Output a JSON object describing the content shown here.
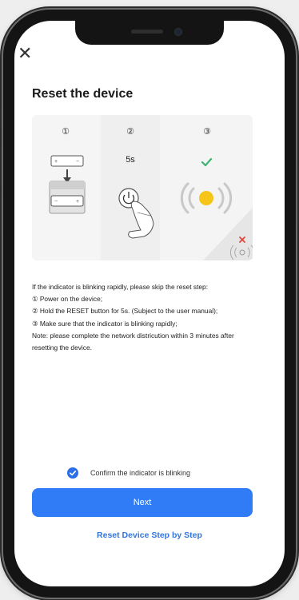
{
  "screen": {
    "close_icon": "close-icon",
    "title": "Reset the device"
  },
  "illustration": {
    "steps": [
      {
        "number": "①",
        "icon": "device-insert-icon"
      },
      {
        "number": "②",
        "hold_time": "5s",
        "icon": "power-button-press-icon"
      },
      {
        "number": "③",
        "icon": "indicator-blinking-icon"
      }
    ],
    "colors": {
      "check": "#3cb371",
      "indicator": "#f5c518",
      "error": "#e0453a"
    }
  },
  "instructions": [
    "If the indicator is blinking rapidly, please skip the reset step:",
    "① Power on the device;",
    "② Hold the RESET button for 5s. (Subject to the user manual);",
    "③ Make sure that the indicator is blinking rapidly;",
    "Note: please complete the network districution within 3 minutes after resetting the device."
  ],
  "confirm": {
    "label": "Confirm the indicator is blinking",
    "checked": true
  },
  "actions": {
    "next_label": "Next",
    "step_link_label": "Reset Device Step by Step"
  },
  "colors": {
    "accent": "#2f7cf6",
    "link": "#2f76e0"
  }
}
